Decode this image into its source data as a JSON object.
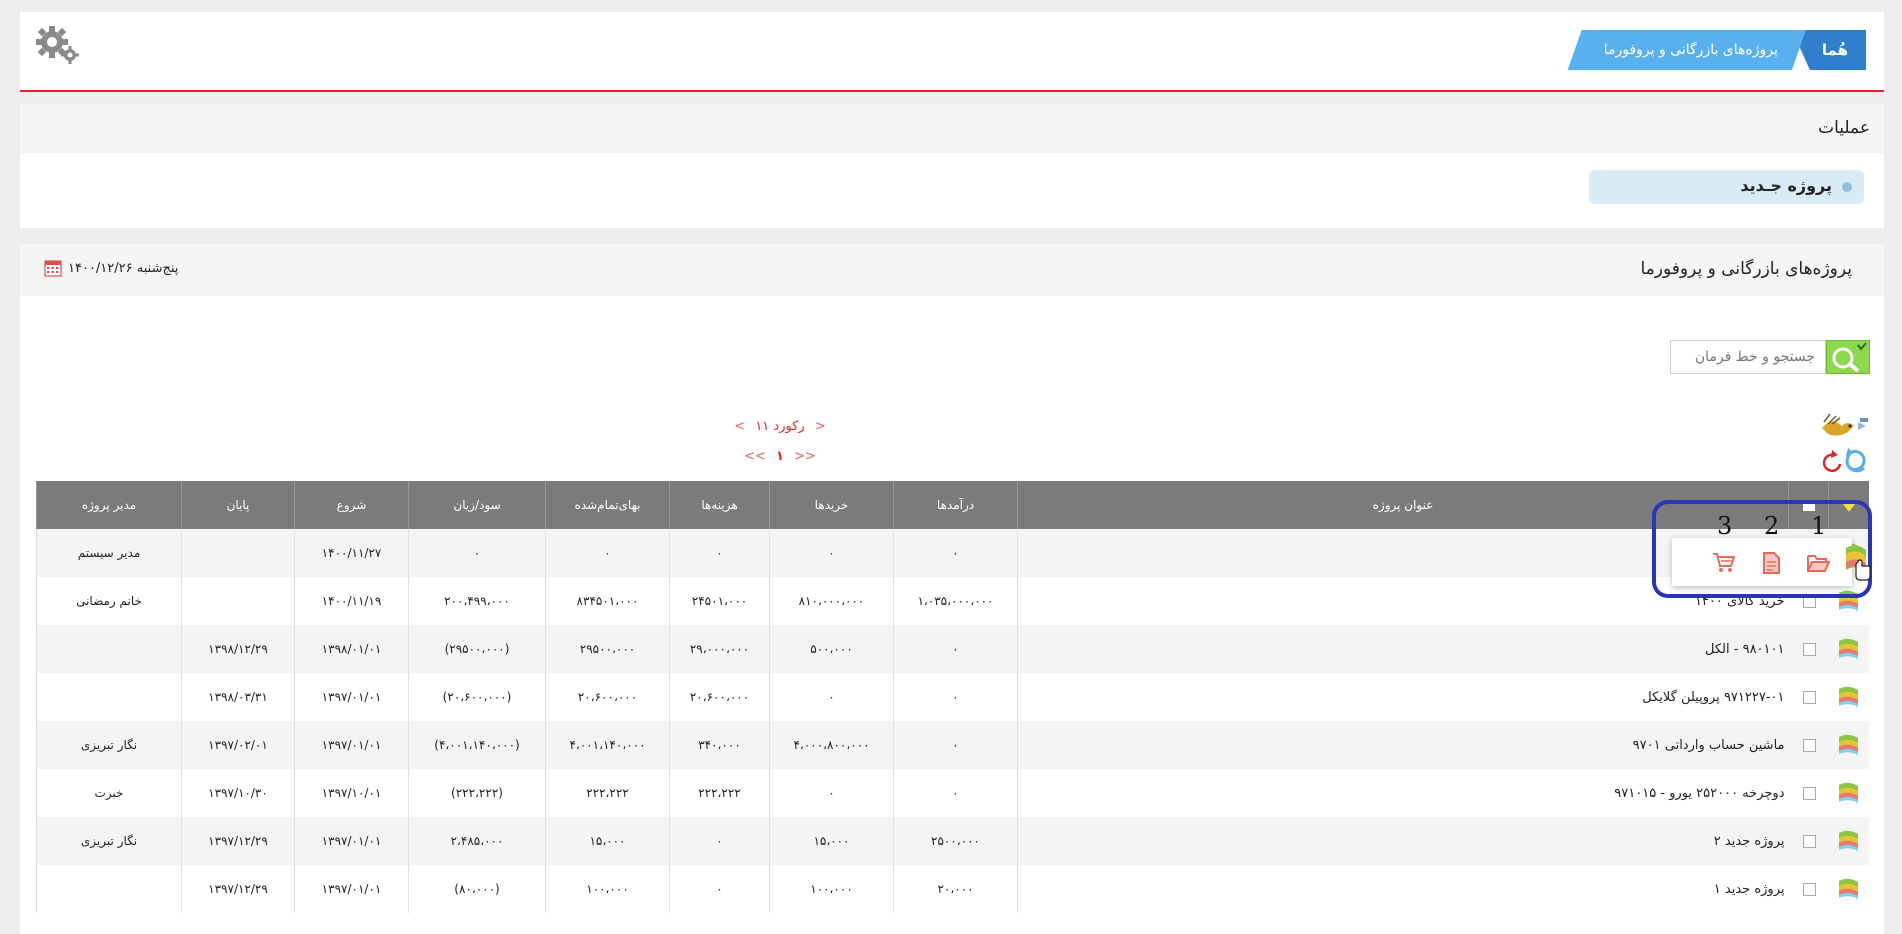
{
  "header": {
    "breadcrumb_home": "هُما",
    "breadcrumb_page": "پروژه‌های بازرگانی و پروفورما"
  },
  "operations": {
    "title": "عملیات",
    "new_project": "پروژه جـدید"
  },
  "main": {
    "title": "پروژه‌های بازرگانی و پروفورما",
    "date": "پنج‌شنبه ۱۴۰۰/۱۲/۲۶"
  },
  "search": {
    "placeholder": "جستجو و خط فرمان"
  },
  "pager": {
    "prev": "<",
    "next": ">",
    "records": "۱۱ رکورد",
    "first": "<<",
    "last": ">>",
    "page": "۱"
  },
  "table": {
    "columns": {
      "title": "عنوان پروژه",
      "income": "درآمدها",
      "purchases": "خریدها",
      "expenses": "هزینه‌ها",
      "cost": "بهای‌تمام‌شده",
      "profit": "سود/زیان",
      "start": "شروع",
      "end": "پایان",
      "manager": "مدیر پروژه"
    },
    "rows": [
      {
        "title": "",
        "income": "۰",
        "purchases": "۰",
        "expenses": "۰",
        "cost": "۰",
        "profit": "۰",
        "start": "۱۴۰۰/۱۱/۲۷",
        "end": "",
        "manager": "مدیر سیستم"
      },
      {
        "title": "خرید کالای ۱۴۰۰",
        "income": "۱،۰۳۵،۰۰۰،۰۰۰",
        "purchases": "۸۱۰،۰۰۰،۰۰۰",
        "expenses": "۲۴۵۰۱،۰۰۰",
        "cost": "۸۳۴۵۰۱،۰۰۰",
        "profit": "۲۰۰،۴۹۹،۰۰۰",
        "start": "۱۴۰۰/۱۱/۱۹",
        "end": "",
        "manager": "خانم رمضانی"
      },
      {
        "title": "۹۸۰۱۰۱ - الکل",
        "income": "۰",
        "purchases": "۵۰۰،۰۰۰",
        "expenses": "۲۹،۰۰۰،۰۰۰",
        "cost": "۲۹۵۰۰،۰۰۰",
        "profit": "(۲۹۵۰۰،۰۰۰)",
        "start": "۱۳۹۸/۰۱/۰۱",
        "end": "۱۳۹۸/۱۲/۲۹",
        "manager": ""
      },
      {
        "title": "۹۷۱۲۲۷-۰۱ پروپیلن گلایکل",
        "income": "۰",
        "purchases": "۰",
        "expenses": "۲۰،۶۰۰،۰۰۰",
        "cost": "۲۰،۶۰۰،۰۰۰",
        "profit": "(۲۰،۶۰۰،۰۰۰)",
        "start": "۱۳۹۷/۰۱/۰۱",
        "end": "۱۳۹۸/۰۳/۳۱",
        "manager": ""
      },
      {
        "title": "ماشین حساب وارداتی ۹۷۰۱",
        "income": "۰",
        "purchases": "۴،۰۰۰،۸۰۰،۰۰۰",
        "expenses": "۳۴۰،۰۰۰",
        "cost": "۴،۰۰۱،۱۴۰،۰۰۰",
        "profit": "(۴،۰۰۱،۱۴۰،۰۰۰)",
        "start": "۱۳۹۷/۰۱/۰۱",
        "end": "۱۳۹۷/۰۲/۰۱",
        "manager": "نگار تبریزی"
      },
      {
        "title": "دوچرخه ۲۵۲۰۰۰ یورو - ۹۷۱۰۱۵",
        "income": "۰",
        "purchases": "۰",
        "expenses": "۲۲۲،۲۲۲",
        "cost": "۲۲۲،۲۲۲",
        "profit": "(۲۲۲،۲۲۲)",
        "start": "۱۳۹۷/۱۰/۰۱",
        "end": "۱۳۹۷/۱۰/۳۰",
        "manager": "خبرت"
      },
      {
        "title": "پروژه جدید ۲",
        "income": "۲۵۰۰،۰۰۰",
        "purchases": "۱۵،۰۰۰",
        "expenses": "۰",
        "cost": "۱۵،۰۰۰",
        "profit": "۲،۴۸۵،۰۰۰",
        "start": "۱۳۹۷/۰۱/۰۱",
        "end": "۱۳۹۷/۱۲/۲۹",
        "manager": "نگار تبریزی"
      },
      {
        "title": "پروژه جدید ۱",
        "income": "۲۰،۰۰۰",
        "purchases": "۱۰۰،۰۰۰",
        "expenses": "۰",
        "cost": "۱۰۰،۰۰۰",
        "profit": "(۸۰،۰۰۰)",
        "start": "۱۳۹۷/۰۱/۰۱",
        "end": "۱۳۹۷/۱۲/۲۹",
        "manager": ""
      }
    ]
  },
  "popup": {
    "label_1": "1",
    "label_2": "2",
    "label_3": "3",
    "icons": [
      "folder-open-icon",
      "document-icon",
      "cart-icon"
    ]
  },
  "colors": {
    "accent_red": "#e0252a",
    "header_blue": "#2f7fcc",
    "crumb_blue": "#58b0ee",
    "table_header": "#7b7b7b",
    "search_green": "#8ed84d",
    "highlight_border": "#2b35b8"
  }
}
